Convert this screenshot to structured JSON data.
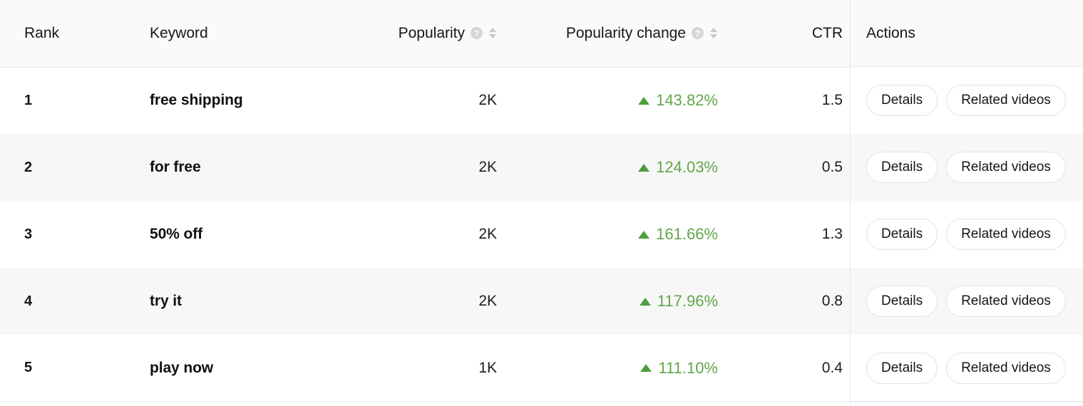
{
  "table": {
    "columns": [
      {
        "key": "rank",
        "label": "Rank",
        "has_help": false,
        "sortable": false,
        "align": "left"
      },
      {
        "key": "keyword",
        "label": "Keyword",
        "has_help": false,
        "sortable": false,
        "align": "left"
      },
      {
        "key": "pop",
        "label": "Popularity",
        "has_help": true,
        "sortable": true,
        "align": "right"
      },
      {
        "key": "change",
        "label": "Popularity change",
        "has_help": true,
        "sortable": true,
        "align": "right"
      },
      {
        "key": "ctr",
        "label": "CTR",
        "has_help": false,
        "sortable": false,
        "align": "right"
      },
      {
        "key": "actions",
        "label": "Actions",
        "has_help": false,
        "sortable": false,
        "align": "left"
      }
    ],
    "help_icon_glyph": "?",
    "trend_up_glyph": "triangle-up",
    "accent_green": "#62a64a",
    "header_bg": "#fafafa",
    "stripe_bg": "#f7f7f8",
    "rows": [
      {
        "rank": "1",
        "keyword": "free shipping",
        "popularity": "2K",
        "change": "143.82%",
        "change_direction": "up",
        "ctr": "1.5"
      },
      {
        "rank": "2",
        "keyword": "for free",
        "popularity": "2K",
        "change": "124.03%",
        "change_direction": "up",
        "ctr": "0.5"
      },
      {
        "rank": "3",
        "keyword": "50% off",
        "popularity": "2K",
        "change": "161.66%",
        "change_direction": "up",
        "ctr": "1.3"
      },
      {
        "rank": "4",
        "keyword": "try it",
        "popularity": "2K",
        "change": "117.96%",
        "change_direction": "up",
        "ctr": "0.8"
      },
      {
        "rank": "5",
        "keyword": "play now",
        "popularity": "1K",
        "change": "111.10%",
        "change_direction": "up",
        "ctr": "0.4"
      }
    ],
    "actions": {
      "details_label": "Details",
      "related_videos_label": "Related videos"
    }
  }
}
